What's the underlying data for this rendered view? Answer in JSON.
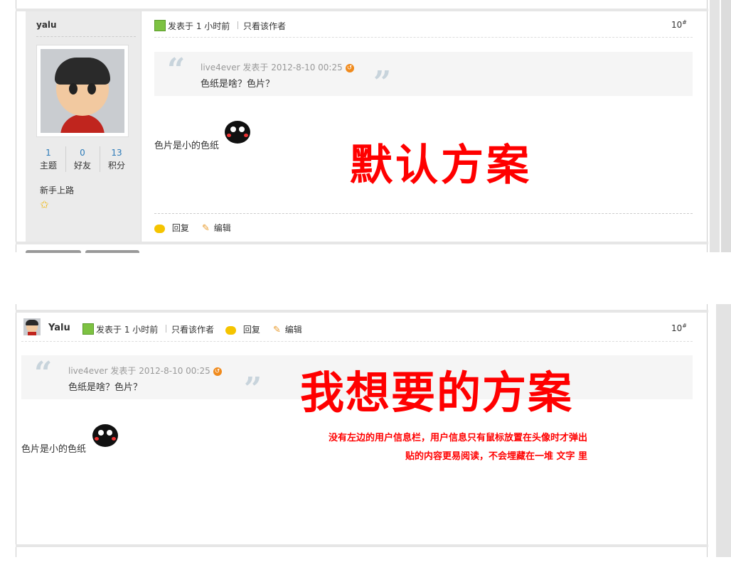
{
  "colors": {
    "accent_red": "#ff0000",
    "link_blue": "#2b7ab8",
    "quote_bg": "#f5f5f5",
    "quote_mark": "#c8d4dc"
  },
  "default_scheme": {
    "username": "yalu",
    "stats": [
      {
        "value": "1",
        "label": "主题"
      },
      {
        "value": "0",
        "label": "好友"
      },
      {
        "value": "13",
        "label": "积分"
      }
    ],
    "rank": "新手上路",
    "meta": {
      "posted": "发表于 1 小时前",
      "only_author": "只看该作者",
      "floor": "10",
      "floor_suffix": "#"
    },
    "quote": {
      "author": "live4ever",
      "posted": "发表于 2012-8-10 00:25",
      "text": "色纸是啥？色片？"
    },
    "body_text": "色片是小的色纸",
    "actions": {
      "reply": "回复",
      "edit": "编辑"
    },
    "caption": "默认方案"
  },
  "desired_scheme": {
    "username": "Yalu",
    "meta": {
      "posted": "发表于 1 小时前",
      "only_author": "只看该作者",
      "reply": "回复",
      "edit": "编辑",
      "floor": "10",
      "floor_suffix": "#"
    },
    "quote": {
      "author": "live4ever",
      "posted": "发表于 2012-8-10 00:25",
      "text": "色纸是啥？色片？"
    },
    "body_text": "色片是小的色纸",
    "caption": "我想要的方案",
    "note_line1": "没有左边的用户信息栏，用户信息只有鼠标放置在头像时才弹出",
    "note_line2": "贴的内容更易阅读，不会埋藏在一堆 文字 里"
  }
}
